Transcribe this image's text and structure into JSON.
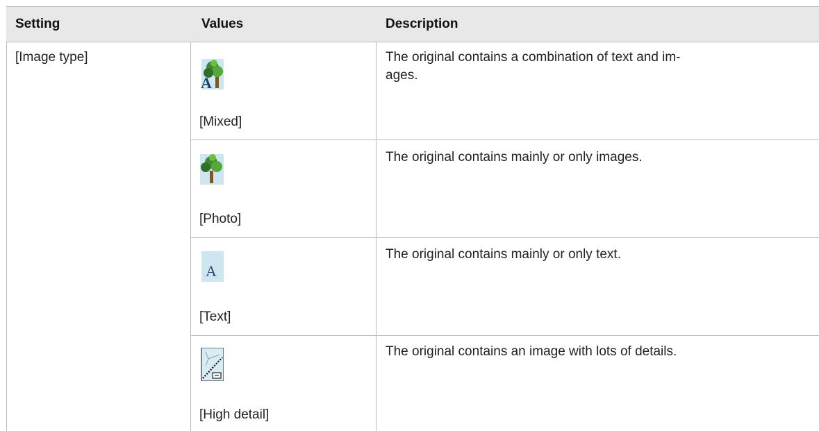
{
  "table": {
    "headers": {
      "setting": "Setting",
      "values": "Values",
      "description": "Description"
    },
    "setting_name": "[Image type]",
    "rows": [
      {
        "icon": "tree-text-icon",
        "value": "[Mixed]",
        "description": "The original contains a combination of text and im-\nages."
      },
      {
        "icon": "tree-icon",
        "value": "[Photo]",
        "description": "The original contains mainly or only images."
      },
      {
        "icon": "letter-a-icon",
        "value": "[Text]",
        "description": "The original contains mainly or only text."
      },
      {
        "icon": "detail-lines-icon",
        "value": "[High detail]",
        "description": "The original contains an image with lots of details."
      }
    ]
  },
  "colors": {
    "header_bg": "#e8e8e8",
    "grid_line": "#b9b9b9",
    "icon_bg": "#cde6f0"
  }
}
